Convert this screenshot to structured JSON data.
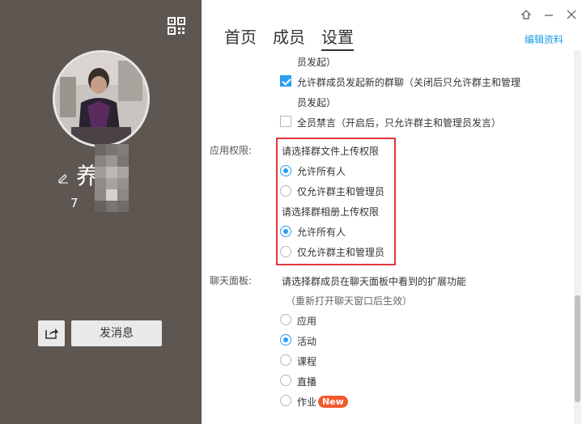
{
  "profile": {
    "name": "养  场",
    "uid": "7",
    "send_message_label": "发消息"
  },
  "tabs": [
    {
      "label": "首页",
      "active": false
    },
    {
      "label": "成员",
      "active": false
    },
    {
      "label": "设置",
      "active": true
    }
  ],
  "edit_profile_label": "编辑资料",
  "settings": {
    "line_top_continuation": "员发起）",
    "allow_new_chat": {
      "line1": "允许群成员发起新的群聊（关闭后只允许群主和管理",
      "line2": "员发起）",
      "checked": true
    },
    "mute_all": {
      "label": "全员禁言（开启后，只允许群主和管理员发言）",
      "checked": false
    },
    "app_permission": {
      "label": "应用权限:",
      "file_title": "请选择群文件上传权限",
      "file_options": [
        "允许所有人",
        "仅允许群主和管理员"
      ],
      "file_selected": 0,
      "album_title": "请选择群相册上传权限",
      "album_options": [
        "允许所有人",
        "仅允许群主和管理员"
      ],
      "album_selected": 0
    },
    "chat_panel": {
      "label": "聊天面板:",
      "title": "请选择群成员在聊天面板中看到的扩展功能",
      "note": "（重新打开聊天窗口后生效）",
      "options": [
        "应用",
        "活动",
        "课程",
        "直播",
        "作业"
      ],
      "selected": 1,
      "new_badge": "New"
    }
  },
  "colors": {
    "left_panel_bg": "#5d5651",
    "accent_blue": "#2b9ef0",
    "highlight_red": "#e0393e",
    "new_badge": "#f25a2e"
  }
}
